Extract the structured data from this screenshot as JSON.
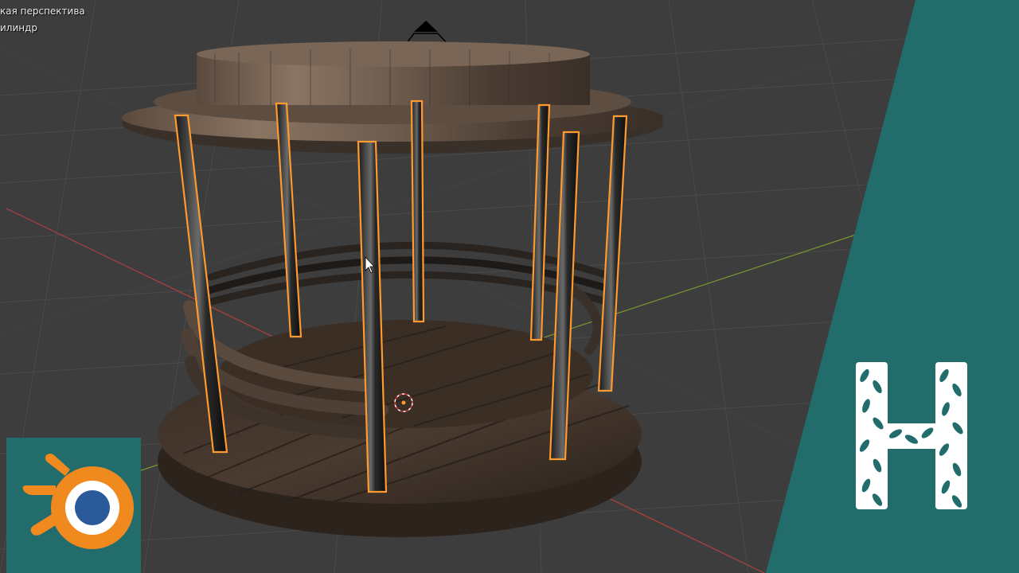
{
  "viewport": {
    "view_label": "кая перспектива",
    "object_label": "илиндр"
  },
  "colors": {
    "grid_background": "#3d3d3d",
    "grid_line": "#4a4a4a",
    "x_axis": "#b24040",
    "y_axis": "#7a9a30",
    "selection_outline": "#ff9a2e",
    "teal_panel": "#226c6c",
    "blender_orange": "#f08a1e",
    "blender_blue": "#2a5a9a",
    "wood_dark": "#3b2f26",
    "wood_light": "#8a7462"
  },
  "branding": {
    "app_logo_icon": "blender-logo-icon",
    "channel_logo_icon": "leaf-letter-h-icon"
  }
}
